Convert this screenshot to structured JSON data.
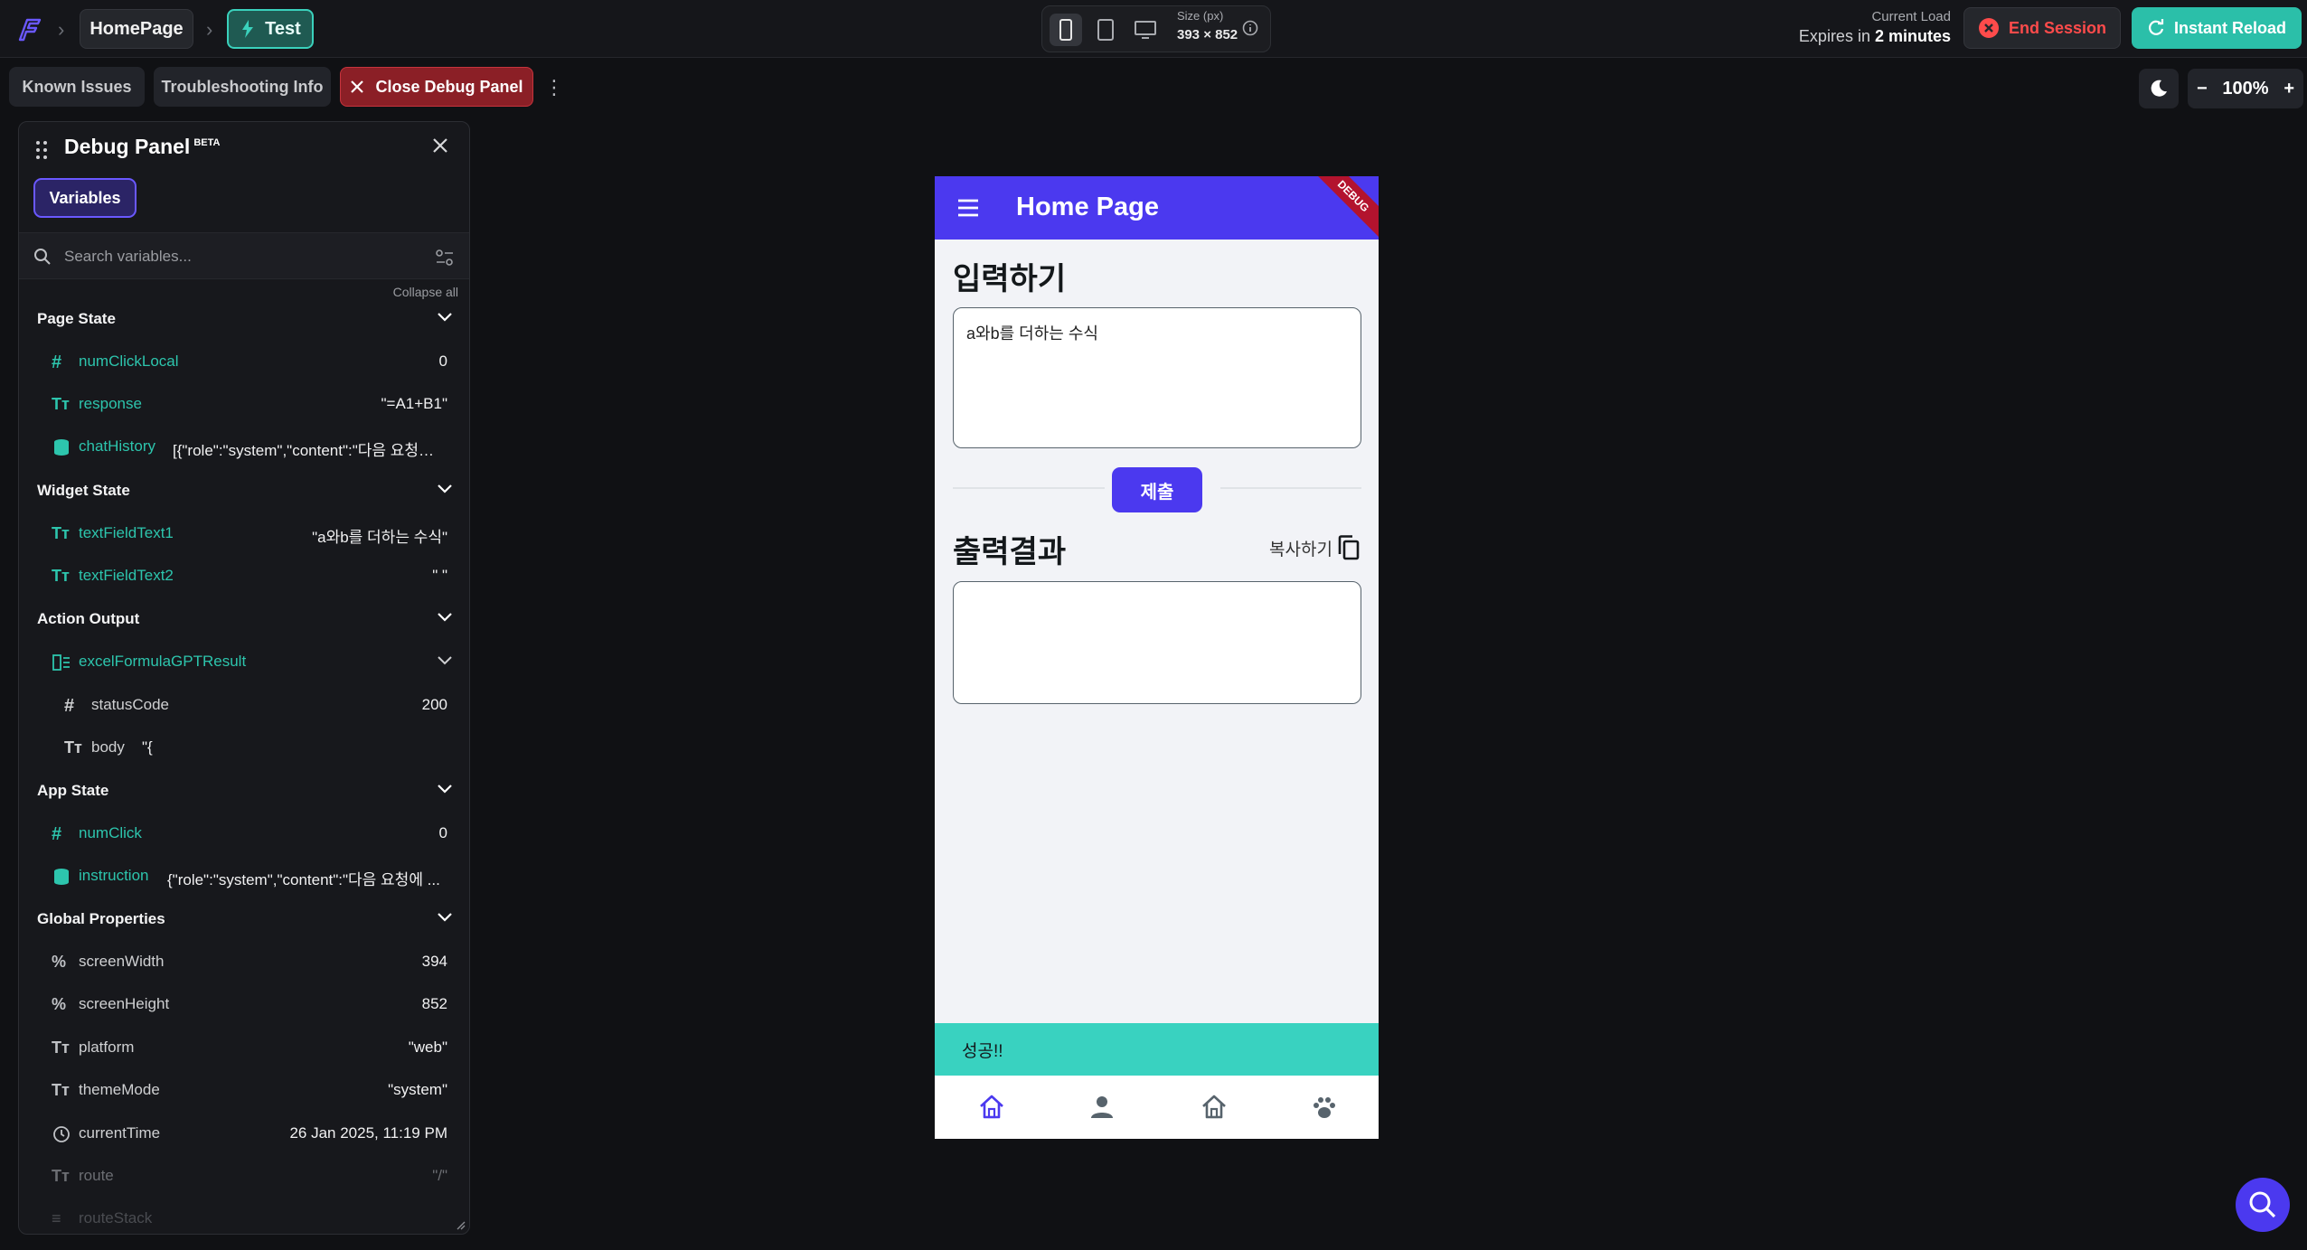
{
  "topbar": {
    "page_name": "HomePage",
    "mode_label": "Test",
    "size_label": "Size (px)",
    "size_value": "393 × 852",
    "load_label": "Current Load",
    "expires_prefix": "Expires in",
    "expires_value": "2 minutes",
    "end_session": "End Session",
    "instant_reload": "Instant Reload"
  },
  "toolbar": {
    "known_issues": "Known Issues",
    "troubleshooting": "Troubleshooting Info",
    "close_debug": "Close Debug Panel",
    "zoom": "100%"
  },
  "debug_panel": {
    "title": "Debug Panel",
    "badge": "BETA",
    "tab_variables": "Variables",
    "search_placeholder": "Search variables...",
    "collapse_all": "Collapse all",
    "sections": {
      "page_state": {
        "title": "Page State",
        "rows": [
          {
            "name": "numClickLocal",
            "value": "0",
            "icon": "hash-icon"
          },
          {
            "name": "response",
            "value": "\"=A1+B1\"",
            "icon": "text-icon"
          },
          {
            "name": "chatHistory",
            "value": "[{\"role\":\"system\",\"content\":\"다음 요청…",
            "icon": "database-icon"
          }
        ]
      },
      "widget_state": {
        "title": "Widget State",
        "rows": [
          {
            "name": "textFieldText1",
            "value": "\"a와b를 더하는 수식\"",
            "icon": "text-icon"
          },
          {
            "name": "textFieldText2",
            "value": "\" \"",
            "icon": "text-icon"
          }
        ]
      },
      "action_output": {
        "title": "Action Output",
        "rows": [
          {
            "name": "excelFormulaGPTResult",
            "value": "",
            "icon": "struct-icon"
          },
          {
            "name": "statusCode",
            "value": "200",
            "icon": "hash-icon"
          },
          {
            "name": "body",
            "value": "\"{",
            "icon": "text-icon"
          }
        ]
      },
      "app_state": {
        "title": "App State",
        "rows": [
          {
            "name": "numClick",
            "value": "0",
            "icon": "hash-icon"
          },
          {
            "name": "instruction",
            "value": "{\"role\":\"system\",\"content\":\"다음 요청에 ...",
            "icon": "database-icon"
          }
        ]
      },
      "global_properties": {
        "title": "Global Properties",
        "rows": [
          {
            "name": "screenWidth",
            "value": "394",
            "icon": "percent-icon"
          },
          {
            "name": "screenHeight",
            "value": "852",
            "icon": "percent-icon"
          },
          {
            "name": "platform",
            "value": "\"web\"",
            "icon": "text-icon"
          },
          {
            "name": "themeMode",
            "value": "\"system\"",
            "icon": "text-icon"
          },
          {
            "name": "currentTime",
            "value": "26 Jan 2025, 11:19 PM",
            "icon": "clock-icon"
          },
          {
            "name": "route",
            "value": "\"/\"",
            "icon": "text-icon"
          },
          {
            "name": "routeStack",
            "value": "",
            "icon": "list-icon"
          }
        ]
      }
    }
  },
  "phone": {
    "app_title": "Home Page",
    "debug_ribbon": "DEBUG",
    "input_heading": "입력하기",
    "input_value": "a와b를 더하는 수식",
    "submit_label": "제출",
    "output_heading": "출력결과",
    "copy_label": "복사하기",
    "output_value": "",
    "snackbar": "성공!!",
    "nav_icons": [
      "home-icon",
      "person-icon",
      "home-outline-icon",
      "paw-icon"
    ]
  },
  "colors": {
    "primary": "#4B39EF",
    "accent": "#39D2C0",
    "teal_text": "#2DC5AD",
    "danger": "#FF4B4B"
  }
}
